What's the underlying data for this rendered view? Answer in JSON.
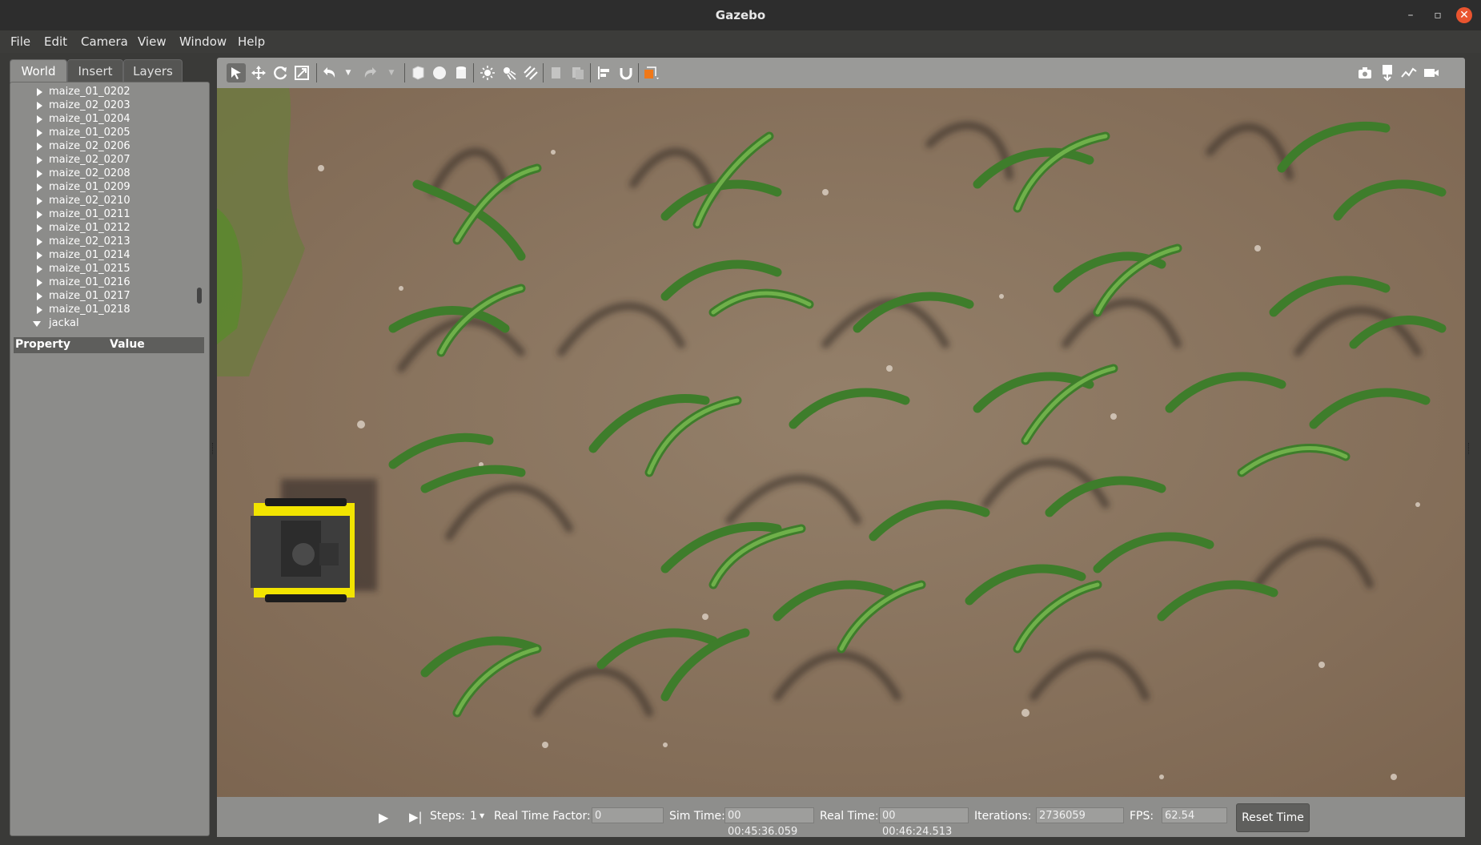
{
  "window": {
    "title": "Gazebo",
    "min_label": "–",
    "max_label": "▫",
    "close_label": "✕"
  },
  "menu": [
    "File",
    "Edit",
    "Camera",
    "View",
    "Window",
    "Help"
  ],
  "tabs": [
    "World",
    "Insert",
    "Layers"
  ],
  "tree": {
    "items": [
      "maize_01_0202",
      "maize_02_0203",
      "maize_01_0204",
      "maize_01_0205",
      "maize_02_0206",
      "maize_02_0207",
      "maize_02_0208",
      "maize_01_0209",
      "maize_02_0210",
      "maize_01_0211",
      "maize_01_0212",
      "maize_02_0213",
      "maize_01_0214",
      "maize_01_0215",
      "maize_01_0216",
      "maize_01_0217",
      "maize_01_0218"
    ],
    "expanded": "jackal"
  },
  "properties": {
    "col1": "Property",
    "col2": "Value"
  },
  "toolbar": {
    "icons": [
      "select-arrow-icon",
      "translate-icon",
      "rotate-icon",
      "scale-icon",
      "undo-icon",
      "undo-dropdown-icon",
      "redo-icon",
      "redo-dropdown-icon",
      "box-icon",
      "sphere-icon",
      "cylinder-icon",
      "point-light-icon",
      "spot-light-icon",
      "directional-light-icon",
      "copy-icon",
      "paste-icon",
      "align-icon",
      "snap-icon",
      "view-angle-icon"
    ],
    "right_icons": [
      "screenshot-icon",
      "log-icon",
      "plot-icon",
      "video-record-icon"
    ]
  },
  "status": {
    "steps_label": "Steps:",
    "steps_value": "1",
    "rtf_label": "Real Time Factor:",
    "rtf_value": "0",
    "sim_label": "Sim Time:",
    "sim_value": "00 00:45:36.059",
    "real_label": "Real Time:",
    "real_value": "00 00:46:24.513",
    "iter_label": "Iterations:",
    "iter_value": "2736059",
    "fps_label": "FPS:",
    "fps_value": "62.54",
    "reset_label": "Reset Time"
  },
  "colors": {
    "soil": "#8a735e",
    "robot_yellow": "#f2e400",
    "leaf": "#3f7a2a"
  }
}
